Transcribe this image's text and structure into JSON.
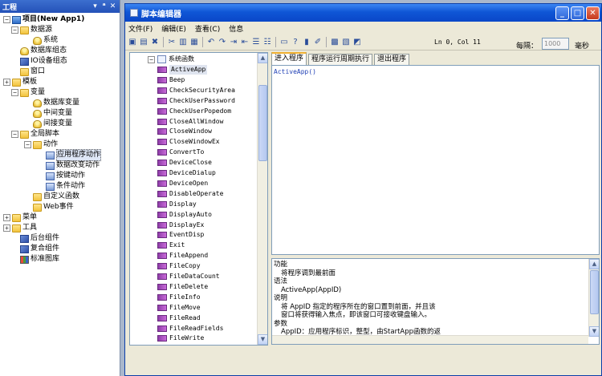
{
  "project_panel": {
    "title": "工程",
    "controls": [
      "▾",
      "ᵃ",
      "✕"
    ],
    "tree": [
      {
        "label": "项目(New App1)",
        "icon": "project-root-icon",
        "expander": "−",
        "bold": true
      },
      {
        "label": "数据源",
        "icon": "folder-icon",
        "expander": "−"
      },
      {
        "label": "系统",
        "icon": "database-icon"
      },
      {
        "label": "数据库组态",
        "icon": "database-config-icon"
      },
      {
        "label": "IO设备组态",
        "icon": "io-device-icon"
      },
      {
        "label": "窗口",
        "icon": "folder-icon"
      },
      {
        "label": "模板",
        "icon": "folder-icon",
        "expander": "+"
      },
      {
        "label": "变量",
        "icon": "folder-icon",
        "expander": "−"
      },
      {
        "label": "数据库变量",
        "icon": "database-icon"
      },
      {
        "label": "中间变量",
        "icon": "database-icon"
      },
      {
        "label": "间接变量",
        "icon": "database-icon"
      },
      {
        "label": "全局脚本",
        "icon": "folder-icon",
        "expander": "−"
      },
      {
        "label": "动作",
        "icon": "folder-icon",
        "expander": "−"
      },
      {
        "label": "应用程序动作",
        "icon": "action-icon",
        "selected": true
      },
      {
        "label": "数据改变动作",
        "icon": "action-icon"
      },
      {
        "label": "按键动作",
        "icon": "action-icon"
      },
      {
        "label": "条件动作",
        "icon": "action-icon"
      },
      {
        "label": "自定义函数",
        "icon": "folder-icon"
      },
      {
        "label": "Web事件",
        "icon": "folder-icon"
      },
      {
        "label": "菜单",
        "icon": "folder-icon",
        "expander": "+"
      },
      {
        "label": "工具",
        "icon": "folder-icon",
        "expander": "+"
      },
      {
        "label": "后台组件",
        "icon": "component-icon"
      },
      {
        "label": "复合组件",
        "icon": "component-icon"
      },
      {
        "label": "标准图库",
        "icon": "library-icon"
      }
    ]
  },
  "editor": {
    "title": "脚本编辑器",
    "window_buttons": [
      "_",
      "□",
      "✕"
    ],
    "menu": [
      "文件(F)",
      "编辑(E)",
      "查看(C)",
      "信息"
    ],
    "toolbar_icons": [
      "save-icon",
      "save-all-icon",
      "delete-icon",
      "cut-icon",
      "copy-icon",
      "paste-icon",
      "undo-icon",
      "redo-icon",
      "indent-icon",
      "outdent-icon",
      "comment-icon",
      "uncomment-icon",
      "find-icon",
      "help-icon",
      "properties-icon",
      "wizard-icon",
      "run-icon",
      "check-icon",
      "db-icon"
    ],
    "toolbar_glyphs": [
      "▣",
      "▤",
      "✖",
      "✂",
      "▥",
      "▦",
      "↶",
      "↷",
      "⇥",
      "⇤",
      "☰",
      "☷",
      "▭",
      "?",
      "▮",
      "✐",
      "▩",
      "▧",
      "◩"
    ],
    "cursor_position": "Ln 0, Col 11",
    "interval_label": "每隔：",
    "interval_value": "1000",
    "interval_unit": "毫秒",
    "function_tree_root": "系统函数",
    "functions": [
      "ActiveApp",
      "Beep",
      "CheckSecurityArea",
      "CheckUserPassword",
      "CheckUserPopedom",
      "CloseAllWindow",
      "CloseWindow",
      "CloseWindowEx",
      "ConvertTo",
      "DeviceClose",
      "DeviceDialup",
      "DeviceOpen",
      "DisableOperate",
      "Display",
      "DisplayAuto",
      "DisplayEx",
      "EventDisp",
      "Exit",
      "FileAppend",
      "FileCopy",
      "FileDataCount",
      "FileDelete",
      "FileInfo",
      "FileMove",
      "FileRead",
      "FileReadFields",
      "FileWrite"
    ],
    "selected_function": "ActiveApp",
    "tabs": [
      "进入程序",
      "程序运行周期执行",
      "退出程序"
    ],
    "active_tab": "进入程序",
    "code": "ActiveApp()",
    "help_lines": [
      {
        "text": "功能",
        "indent": false
      },
      {
        "text": "将程序调到最前面",
        "indent": true
      },
      {
        "text": "语法",
        "indent": false
      },
      {
        "text": "ActiveApp(AppID)",
        "indent": true
      },
      {
        "text": "说明",
        "indent": false
      },
      {
        "text": "将 AppID 指定的程序所在的窗口置到前面，并且该",
        "indent": true
      },
      {
        "text": "窗口将获得输入焦点，即该窗口可接收键盘输入。",
        "indent": true
      },
      {
        "text": "参数",
        "indent": false
      },
      {
        "text": "AppID：应用程序标识，整型，由StartApp函数的返",
        "indent": true
      }
    ]
  }
}
